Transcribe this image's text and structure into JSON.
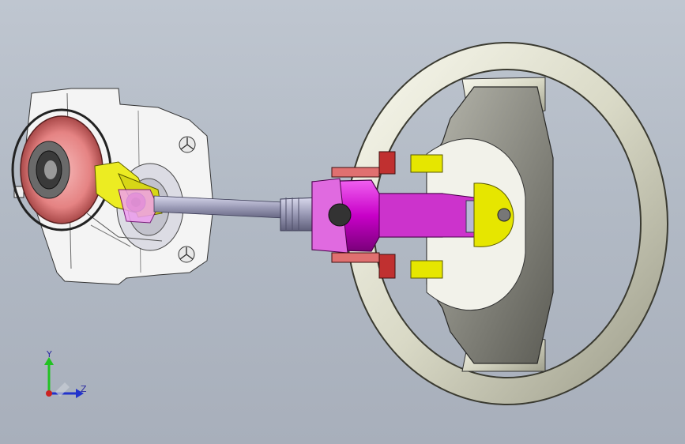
{
  "viewport": {
    "background_top": "#bfc6d0",
    "background_bottom": "#a8afbb"
  },
  "model": {
    "parts": [
      {
        "name": "steering-wheel",
        "color": "#e8e8d8"
      },
      {
        "name": "airbag-cover",
        "color": "#8f8f87"
      },
      {
        "name": "steering-column-housing",
        "color": "#d400d4"
      },
      {
        "name": "intermediate-shaft",
        "color": "#9b9bb4"
      },
      {
        "name": "mounting-bracket",
        "color": "#f2f2f2"
      },
      {
        "name": "universal-joint",
        "color": "#e0e000"
      },
      {
        "name": "clock-spring",
        "color": "#e07d7d"
      },
      {
        "name": "column-brackets",
        "color": "#c03030"
      }
    ]
  },
  "triad": {
    "y_label": "Y",
    "z_label": "Z",
    "y_color": "#22c222",
    "z_color": "#2233cc",
    "origin_color": "#cc2222"
  }
}
